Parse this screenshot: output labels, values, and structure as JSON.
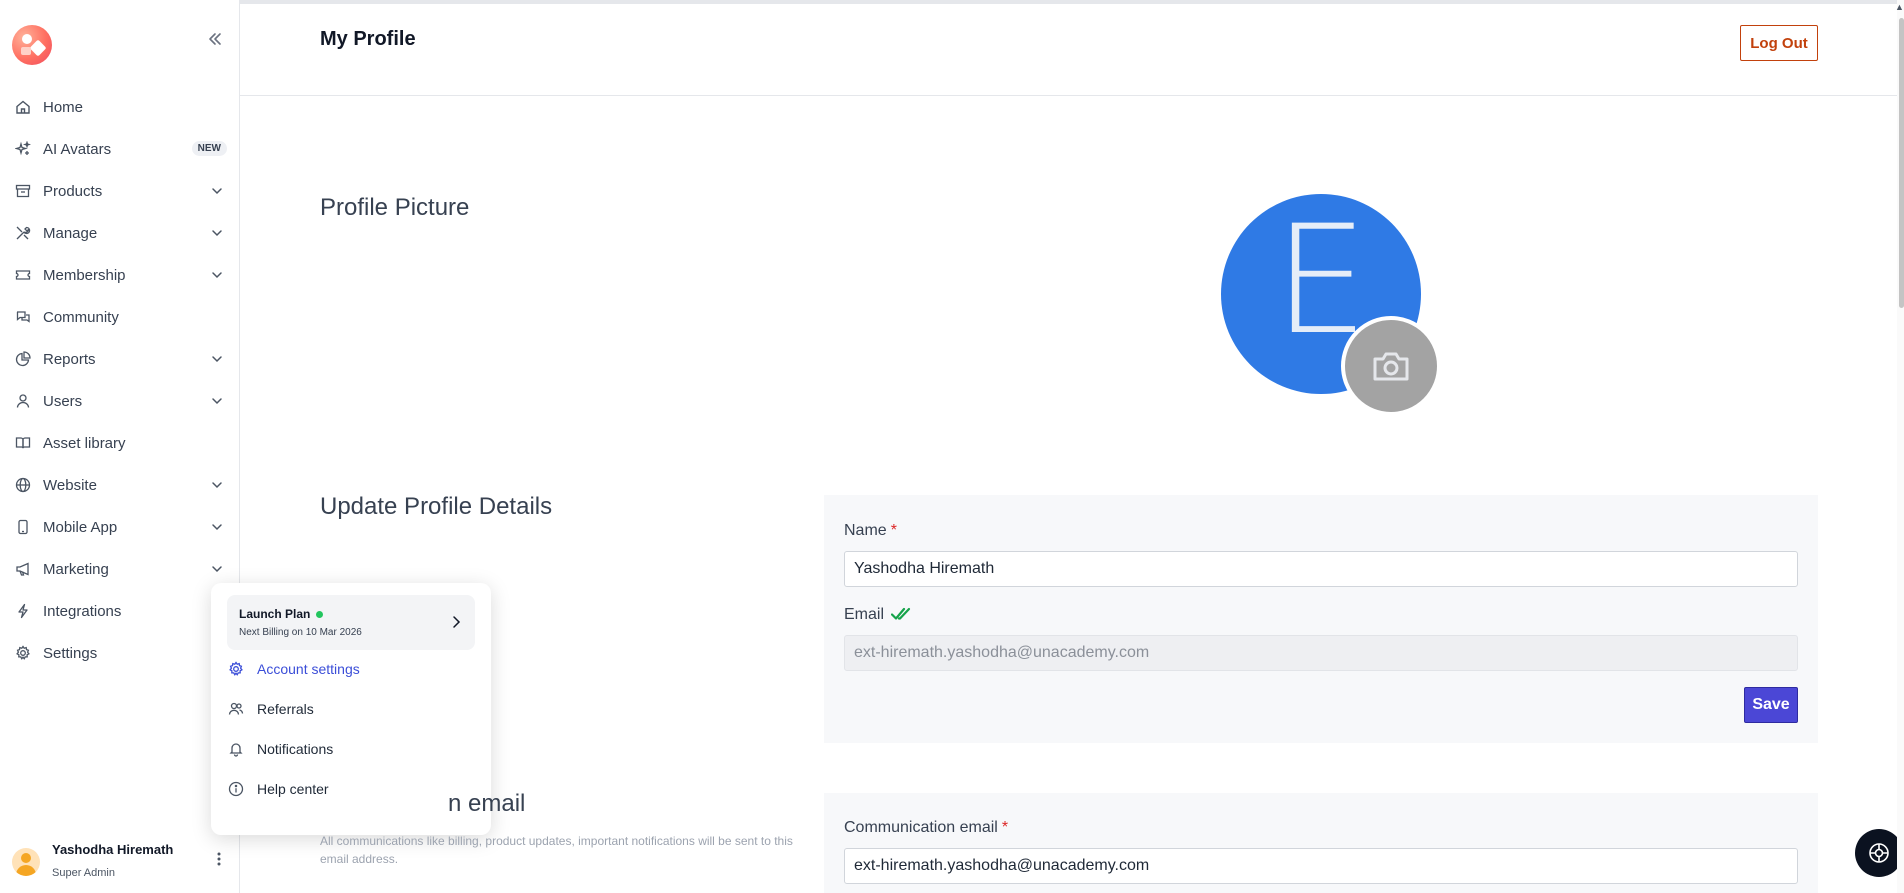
{
  "sidebar": {
    "logo_icon": "logo-icon",
    "collapse_icon": "double-chevron-left-icon",
    "items": [
      {
        "label": "Home",
        "icon": "home-icon",
        "has_chevron": false
      },
      {
        "label": "AI Avatars",
        "icon": "sparkles-icon",
        "badge": "NEW",
        "has_chevron": false
      },
      {
        "label": "Products",
        "icon": "archive-box-icon",
        "has_chevron": true
      },
      {
        "label": "Manage",
        "icon": "tools-icon",
        "has_chevron": true
      },
      {
        "label": "Membership",
        "icon": "ticket-icon",
        "has_chevron": true
      },
      {
        "label": "Community",
        "icon": "chat-icon",
        "has_chevron": false
      },
      {
        "label": "Reports",
        "icon": "pie-chart-icon",
        "has_chevron": true
      },
      {
        "label": "Users",
        "icon": "user-icon",
        "has_chevron": true
      },
      {
        "label": "Asset library",
        "icon": "book-icon",
        "has_chevron": false
      },
      {
        "label": "Website",
        "icon": "globe-icon",
        "has_chevron": true
      },
      {
        "label": "Mobile App",
        "icon": "mobile-icon",
        "has_chevron": true
      },
      {
        "label": "Marketing",
        "icon": "megaphone-icon",
        "has_chevron": true
      },
      {
        "label": "Integrations",
        "icon": "bolt-icon",
        "has_chevron": false
      },
      {
        "label": "Settings",
        "icon": "gear-icon",
        "has_chevron": false
      }
    ],
    "user": {
      "name": "Yashodha Hiremath",
      "role": "Super Admin"
    }
  },
  "popup": {
    "plan": {
      "title": "Launch Plan",
      "subtitle": "Next Billing on 10 Mar 2026",
      "status_color": "#22c55e"
    },
    "items": [
      {
        "label": "Account settings",
        "icon": "gear-icon",
        "active": true
      },
      {
        "label": "Referrals",
        "icon": "users-icon",
        "active": false
      },
      {
        "label": "Notifications",
        "icon": "bell-icon",
        "active": false
      },
      {
        "label": "Help center",
        "icon": "info-icon",
        "active": false
      }
    ]
  },
  "header": {
    "title": "My Profile",
    "logout_label": "Log Out"
  },
  "profile_picture": {
    "section_title": "Profile Picture",
    "initial": "E",
    "avatar_color": "#2f7ae5",
    "camera_icon": "camera-icon"
  },
  "profile_details": {
    "section_title": "Update Profile Details",
    "name_label": "Name",
    "name_value": "Yashodha Hiremath",
    "email_label": "Email",
    "email_verified_icon": "double-check-icon",
    "email_value": "ext-hiremath.yashodha@unacademy.com",
    "save_label": "Save",
    "required_mark": "*"
  },
  "communication_email": {
    "section_title_visible": "n email",
    "description": "All communications like billing, product updates, important notifications will be sent to this email address.",
    "field_label": "Communication email",
    "field_value": "ext-hiremath.yashodha@unacademy.com",
    "required_mark": "*"
  },
  "colors": {
    "accent": "#4b47d6",
    "logout": "#c2410c",
    "link_active": "#3b4ed8"
  }
}
